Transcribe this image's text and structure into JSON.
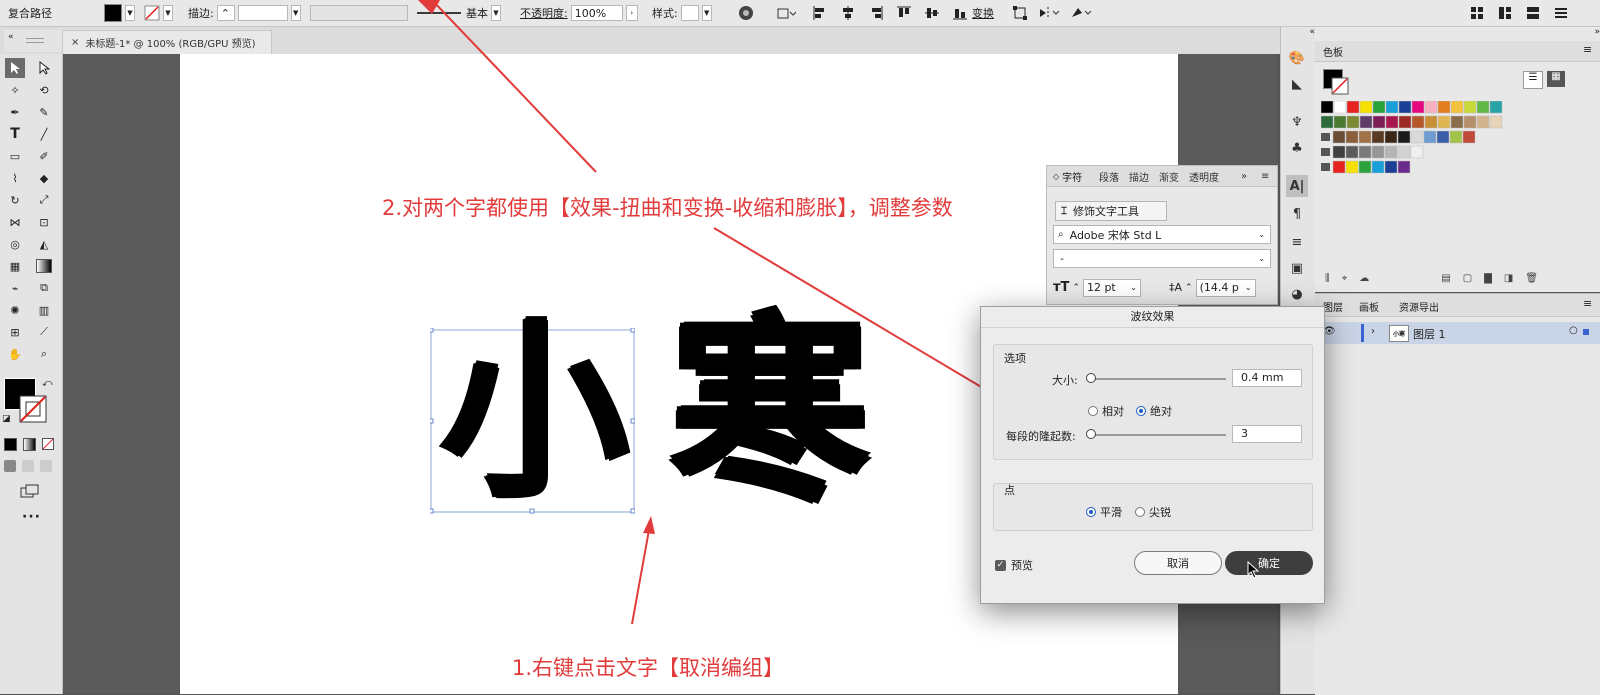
{
  "control_bar": {
    "object_type": "复合路径",
    "stroke_label": "描边:",
    "stroke_style": "基本",
    "opacity_label": "不透明度:",
    "opacity_value": "100%",
    "style_label": "样式:",
    "transform_label": "变换"
  },
  "document": {
    "tab_title": "未标题-1* @ 100% (RGB/GPU 预览)"
  },
  "artwork": {
    "char1": "小",
    "char2": "寒"
  },
  "annotations": {
    "step2": "2.对两个字都使用【效果-扭曲和变换-收缩和膨胀】，调整参数",
    "step1": "1.右键点击文字【取消编组】",
    "color": "#e23b3b"
  },
  "char_panel": {
    "tabs": [
      "字符",
      "段落",
      "描边",
      "渐变",
      "透明度"
    ],
    "touch_tool": "修饰文字工具",
    "font_family": "Adobe 宋体 Std L",
    "font_style": "-",
    "font_size": "12 pt",
    "leading": "(14.4 p"
  },
  "swatches_panel": {
    "title": "色板",
    "colors_row1": [
      "#000000",
      "#ffffff",
      "#e6231e",
      "#f5e100",
      "#2aa33c",
      "#1aa0d8",
      "#1b3f94",
      "#e4087e",
      "#f6b0c0",
      "#e27d22",
      "#f3c23f",
      "#c8d93b",
      "#62b847",
      "#27a3a6"
    ],
    "colors_row2": [
      "#2e6b3a",
      "#4b7b31",
      "#7c8a33",
      "#5f3b6a",
      "#7d1c56",
      "#a8174e",
      "#9e2a25",
      "#b4582c",
      "#c98f36",
      "#e0b653",
      "#8a6b4b",
      "#b78f6a",
      "#d4b48e",
      "#e8d3b7"
    ],
    "colors_row3": [
      "#6b4c36",
      "#8a5f3a",
      "#a17148",
      "#5b3a24",
      "#3c2618",
      "#1b1b1b",
      "#d9d9d9",
      "#6e9bd1",
      "#3a5fa8",
      "#a2c24a",
      "#c04a3a"
    ],
    "colors_row4": [
      "#3f3f3f",
      "#5c5c5c",
      "#7a7a7a",
      "#979797",
      "#b5b5b5",
      "#d2d2d2",
      "#efefef"
    ],
    "colors_row5": [
      "#e6231e",
      "#f5e100",
      "#2aa33c",
      "#1aa0d8",
      "#1b3f94",
      "#6a2c8c"
    ]
  },
  "layers_panel": {
    "tabs": [
      "图层",
      "画板",
      "资源导出"
    ],
    "layer_name": "图层 1",
    "layer_thumb": "小寒"
  },
  "dialog": {
    "title": "波纹效果",
    "options_group": "选项",
    "size_label": "大小:",
    "size_value": "0.4 mm",
    "relative_label": "相对",
    "absolute_label": "绝对",
    "ridges_label": "每段的隆起数:",
    "ridges_value": "3",
    "points_group": "点",
    "smooth_label": "平滑",
    "corner_label": "尖锐",
    "preview_label": "预览",
    "cancel_label": "取消",
    "ok_label": "确定"
  }
}
